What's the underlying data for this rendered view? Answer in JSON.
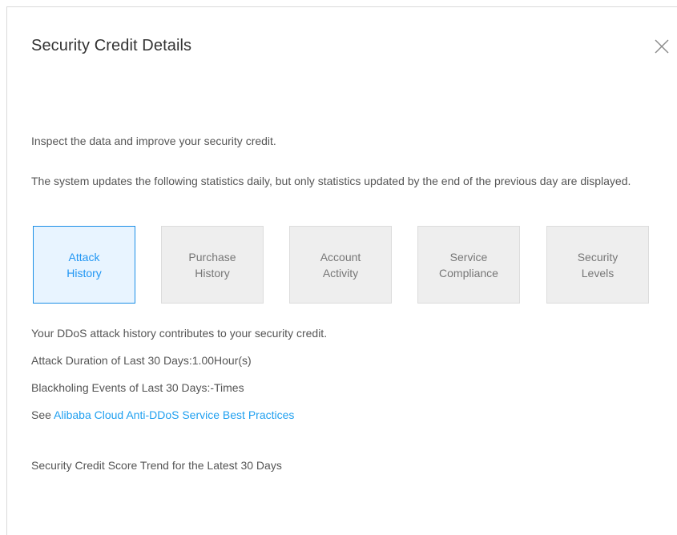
{
  "dialog": {
    "title": "Security Credit Details",
    "close_icon": "close-icon"
  },
  "intro": {
    "line1": "Inspect the data and improve your security credit.",
    "line2": "The system updates the following statistics daily, but only statistics updated by the end of the previous day are displayed."
  },
  "tabs": [
    {
      "label": "Attack\nHistory",
      "active": true
    },
    {
      "label": "Purchase\nHistory",
      "active": false
    },
    {
      "label": "Account\nActivity",
      "active": false
    },
    {
      "label": "Service\nCompliance",
      "active": false
    },
    {
      "label": "Security\nLevels",
      "active": false
    }
  ],
  "attack_history": {
    "description": "Your DDoS attack history contributes to your security credit.",
    "duration": "Attack Duration of Last 30 Days:1.00Hour(s)",
    "blackholing": "Blackholing Events of Last 30 Days:-Times",
    "see_prefix": "See ",
    "link_text": "Alibaba Cloud Anti-DDoS Service Best Practices",
    "trend_title": "Security Credit Score Trend for the Latest 30 Days"
  },
  "colors": {
    "accent": "#2196f3",
    "link": "#20a0f0",
    "tab_bg": "#eeeeee",
    "active_tab_bg": "#e8f4ff"
  }
}
